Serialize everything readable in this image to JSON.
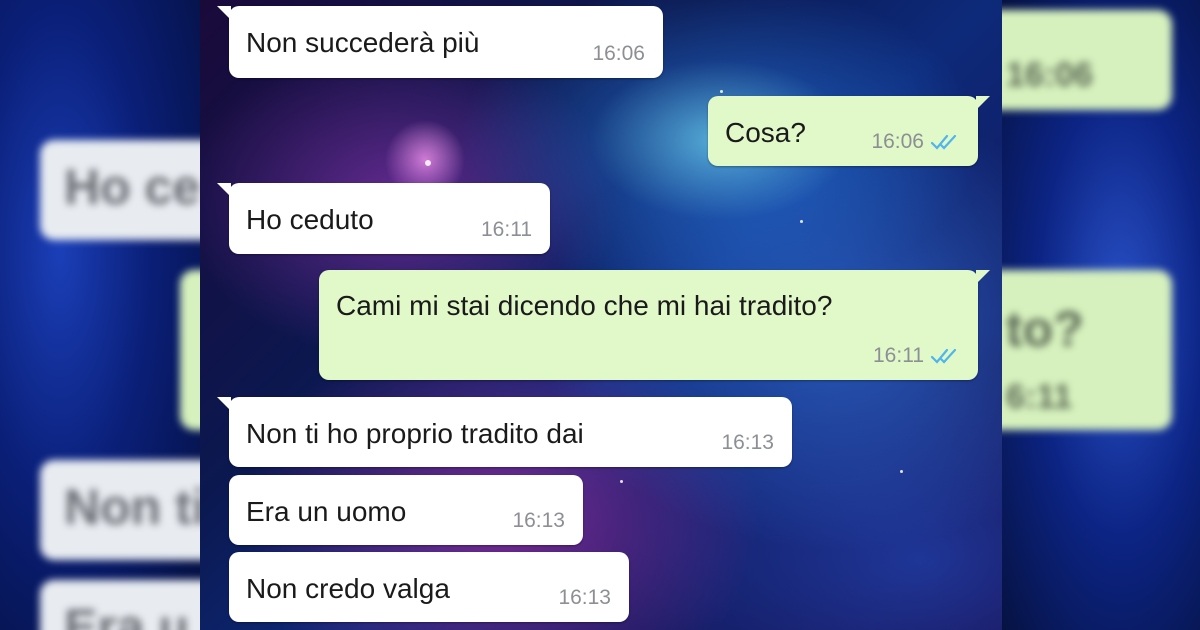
{
  "colors": {
    "incoming_bubble": "#ffffff",
    "outgoing_bubble": "#e1f8c9",
    "timestamp": "#8c9094",
    "read_ticks": "#4fb6ec"
  },
  "messages": [
    {
      "direction": "incoming",
      "text": "Non succederà più",
      "time": "16:06"
    },
    {
      "direction": "outgoing",
      "text": "Cosa?",
      "time": "16:06",
      "status_icon": "double-check-icon"
    },
    {
      "direction": "incoming",
      "text": "Ho ceduto",
      "time": "16:11"
    },
    {
      "direction": "outgoing",
      "text": "Cami mi stai dicendo che mi hai tradito?",
      "time": "16:11",
      "status_icon": "double-check-icon"
    },
    {
      "direction": "incoming",
      "text": "Non ti ho proprio tradito dai",
      "time": "16:13"
    },
    {
      "direction": "incoming",
      "text": "Era un uomo",
      "time": "16:13"
    },
    {
      "direction": "incoming",
      "text": "Non credo valga",
      "time": "16:13"
    }
  ],
  "blurred_left": [
    "Ho ce",
    "Non ti",
    "Era u"
  ],
  "blurred_right": [
    "16:06",
    "to?",
    "6:11"
  ]
}
